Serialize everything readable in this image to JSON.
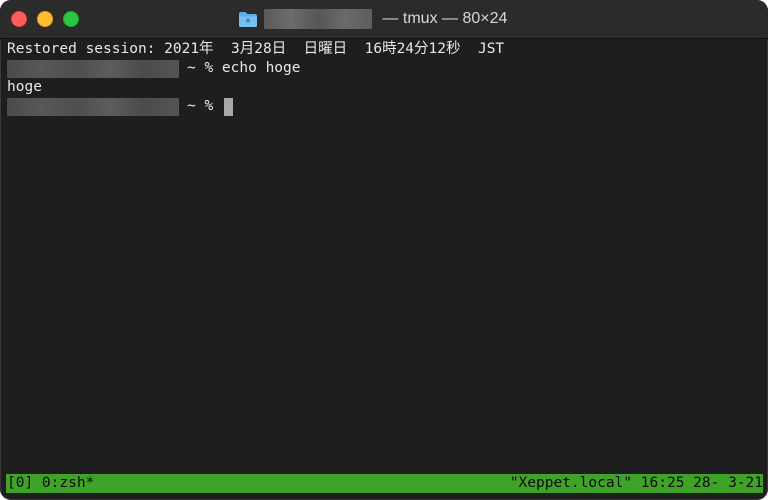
{
  "window": {
    "title_suffix": " — tmux — 80×24",
    "folder_icon": "folder-icon",
    "buttons": [
      "close",
      "minimize",
      "zoom"
    ]
  },
  "terminal": {
    "restored_line": "Restored session: 2021年  3月28日  日曜日  16時24分12秒  JST",
    "prompt_1": "~ % echo hoge",
    "output_1": "hoge",
    "prompt_2": "~ % "
  },
  "statusbar": {
    "left": "[0] 0:zsh*",
    "right": "\"Xeppet.local\" 16:25 28- 3-21",
    "color": "#3fa329"
  }
}
